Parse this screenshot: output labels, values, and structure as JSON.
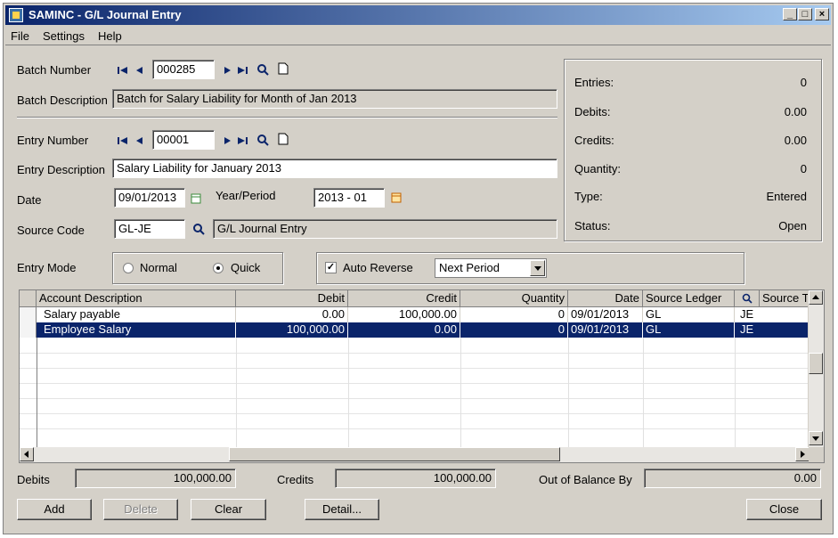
{
  "window": {
    "title": "SAMINC - G/L Journal Entry"
  },
  "menu": [
    {
      "label": "File"
    },
    {
      "label": "Settings"
    },
    {
      "label": "Help"
    }
  ],
  "batch": {
    "number_label": "Batch Number",
    "number": "000285",
    "description_label": "Batch Description",
    "description": "Batch for Salary Liability for Month of Jan 2013"
  },
  "entry": {
    "number_label": "Entry Number",
    "number": "00001",
    "description_label": "Entry Description",
    "description": "Salary Liability for January 2013",
    "date_label": "Date",
    "date": "09/01/2013",
    "year_period_label": "Year/Period",
    "year_period": "2013 - 01",
    "source_code_label": "Source Code",
    "source_code": "GL-JE",
    "source_code_desc": "G/L Journal Entry",
    "mode_label": "Entry Mode",
    "mode_normal": "Normal",
    "mode_quick": "Quick",
    "auto_reverse_label": "Auto Reverse",
    "auto_reverse_checked": true,
    "reverse_option": "Next Period"
  },
  "stats": [
    {
      "label": "Entries:",
      "value": "0"
    },
    {
      "label": "Debits:",
      "value": "0.00"
    },
    {
      "label": "Credits:",
      "value": "0.00"
    },
    {
      "label": "Quantity:",
      "value": "0"
    },
    {
      "label": "Type:",
      "value": "Entered"
    },
    {
      "label": "Status:",
      "value": "Open"
    }
  ],
  "grid": {
    "columns": [
      "Account Description",
      "Debit",
      "Credit",
      "Quantity",
      "Date",
      "Source Ledger",
      "Source T"
    ],
    "rows": [
      {
        "desc": "Salary payable",
        "debit": "0.00",
        "credit": "100,000.00",
        "qty": "0",
        "date": "09/01/2013",
        "ledger": "GL",
        "source": "JE"
      },
      {
        "desc": "Employee Salary",
        "debit": "100,000.00",
        "credit": "0.00",
        "qty": "0",
        "date": "09/01/2013",
        "ledger": "GL",
        "source": "JE"
      }
    ],
    "selected_row": 1
  },
  "totals": {
    "debits_label": "Debits",
    "debits": "100,000.00",
    "credits_label": "Credits",
    "credits": "100,000.00",
    "oob_label": "Out of Balance By",
    "oob": "0.00"
  },
  "buttons": {
    "add": "Add",
    "delete": "Delete",
    "clear": "Clear",
    "detail": "Detail...",
    "close": "Close"
  },
  "colors": {
    "title_start": "#0a246a",
    "title_end": "#a6caf0",
    "selection": "#0a246a",
    "face": "#d4d0c8"
  }
}
